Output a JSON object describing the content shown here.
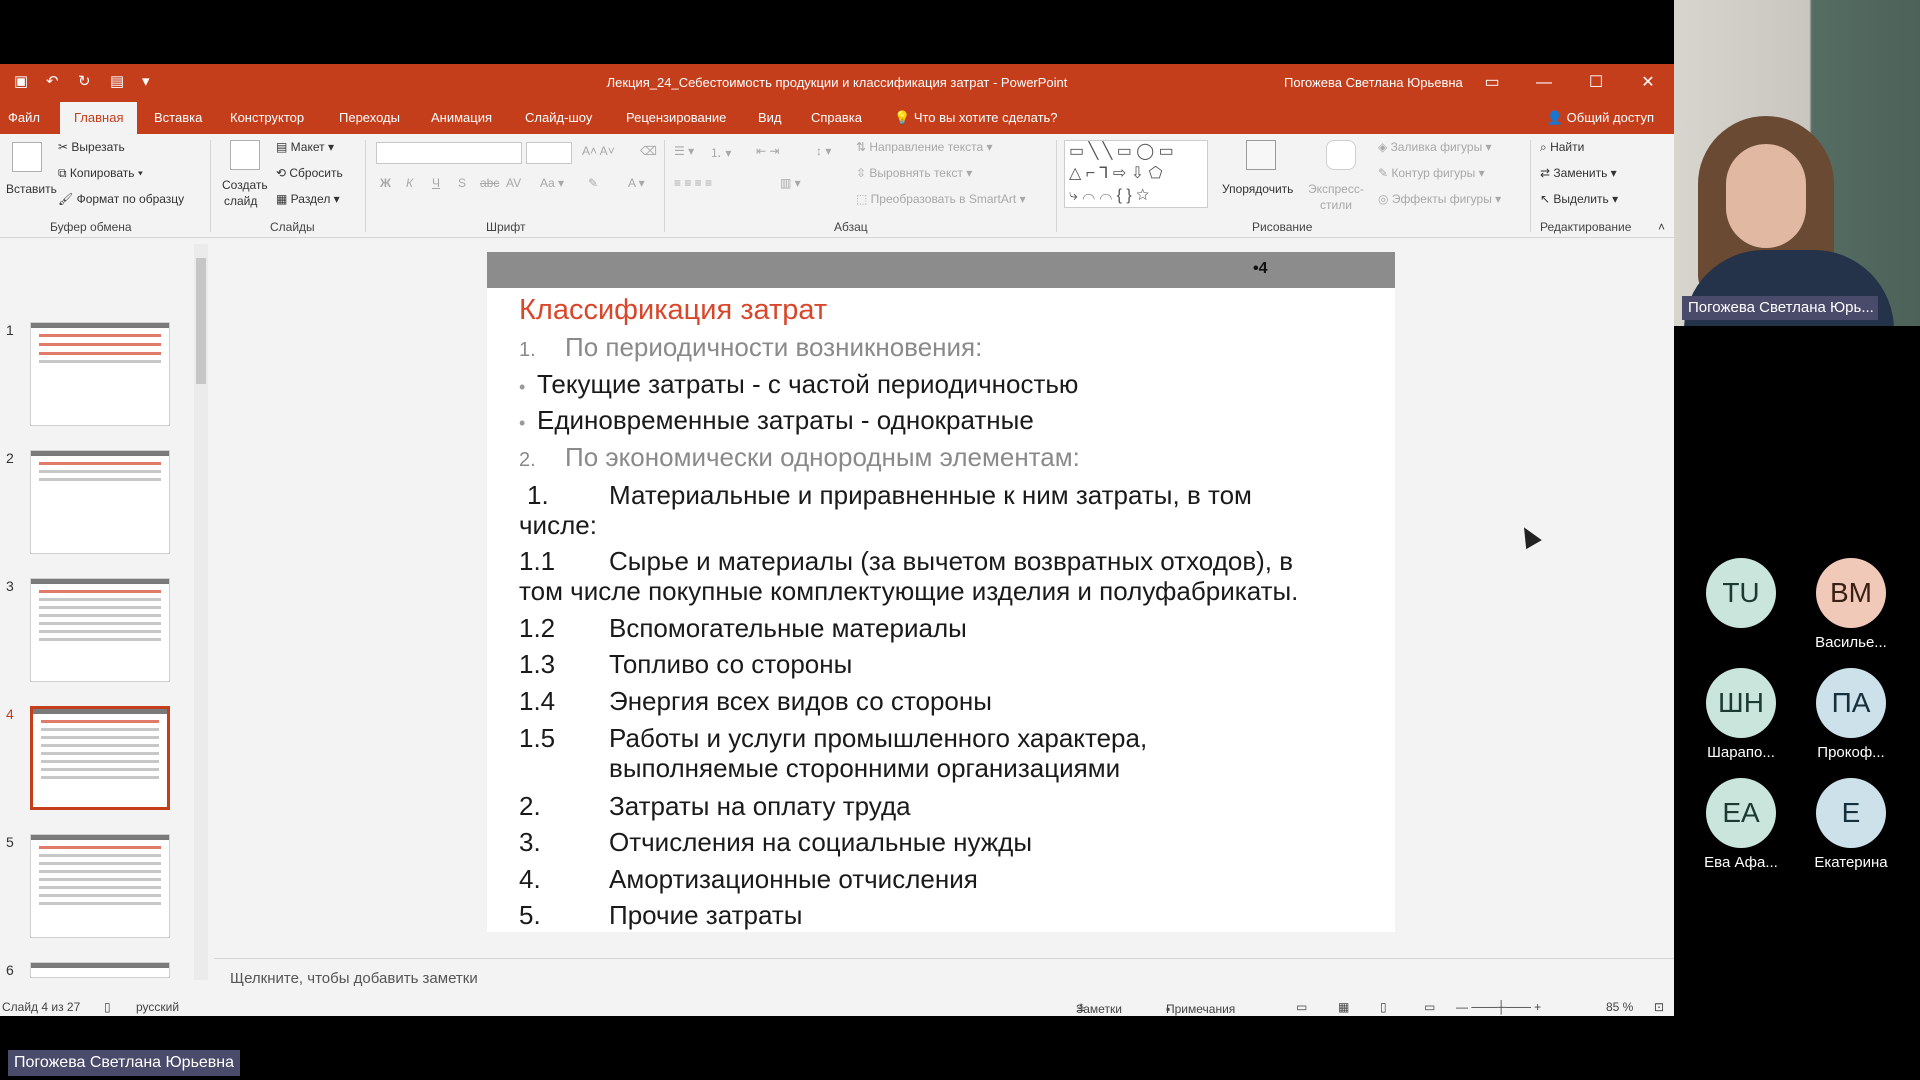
{
  "titlebar": {
    "document_title": "Лекция_24_Себестоимость продукции и классификация затрат  -  PowerPoint",
    "user": "Погожева Светлана Юрьевна"
  },
  "tabs": [
    "Файл",
    "Главная",
    "Вставка",
    "Конструктор",
    "Переходы",
    "Анимация",
    "Слайд-шоу",
    "Рецензирование",
    "Вид",
    "Справка",
    "Что вы хотите сделать?"
  ],
  "share_label": "Общий доступ",
  "ribbon": {
    "clipboard": {
      "paste": "Вставить",
      "cut": "Вырезать",
      "copy": "Копировать",
      "format_painter": "Формат по образцу",
      "label": "Буфер обмена"
    },
    "slides": {
      "new_slide_1": "Создать",
      "new_slide_2": "слайд",
      "layout": "Макет",
      "reset": "Сбросить",
      "section": "Раздел",
      "label": "Слайды"
    },
    "font": {
      "label": "Шрифт"
    },
    "paragraph": {
      "text_direction": "Направление текста",
      "align_text": "Выровнять текст",
      "smartart": "Преобразовать в SmartArt",
      "label": "Абзац"
    },
    "drawing": {
      "arrange": "Упорядочить",
      "quick_styles_1": "Экспресс-",
      "quick_styles_2": "стили",
      "fill": "Заливка фигуры",
      "outline": "Контур фигуры",
      "effects": "Эффекты фигуры",
      "label": "Рисование"
    },
    "editing": {
      "find": "Найти",
      "replace": "Заменить",
      "select": "Выделить",
      "label": "Редактирование"
    }
  },
  "thumbnails": [
    "1",
    "2",
    "3",
    "4",
    "5",
    "6"
  ],
  "slide": {
    "number": "•4",
    "title": "Классификация затрат",
    "s1_num": "1.",
    "s1_text": "По периодичности возникновения:",
    "b1": "Текущие затраты - с частой периодичностью",
    "b2": "Единовременные затраты - однократные",
    "s2_num": "2.",
    "s2_text": "По экономически однородным элементам:",
    "i1_num": "1.",
    "i1_text_a": "Материальные и приравненные к ним затраты, в том",
    "i1_text_b": "числе:",
    "i11_num": "1.1",
    "i11_text_a": "Сырье и материалы (за вычетом возвратных отходов), в",
    "i11_text_b": "том числе покупные комплектующие изделия и полуфабрикаты.",
    "i12_num": "1.2",
    "i12_text": "Вспомогательные материалы",
    "i13_num": "1.3",
    "i13_text": "Топливо со стороны",
    "i14_num": "1.4",
    "i14_text": "Энергия всех видов со стороны",
    "i15_num": "1.5",
    "i15_text_a": "Работы и услуги промышленного характера,",
    "i15_text_b": "выполняемые сторонними организациями",
    "i2_num": "2.",
    "i2_text": "Затраты на оплату труда",
    "i3_num": "3.",
    "i3_text": "Отчисления на социальные нужды",
    "i4_num": "4.",
    "i4_text": "Амортизационные отчисления",
    "i5_num": "5.",
    "i5_text": "Прочие затраты"
  },
  "notes_placeholder": "Щелкните, чтобы добавить заметки",
  "status": {
    "slide_of": "Слайд 4 из 27",
    "language": "русский",
    "notes": "Заметки",
    "comments": "Примечания",
    "zoom": "85 %"
  },
  "video": {
    "name": "Погожева Светлана Юрь..."
  },
  "participants": [
    {
      "initials": "TU",
      "name": ""
    },
    {
      "initials": "BM",
      "name": "Васильe..."
    },
    {
      "initials": "ШН",
      "name": "Шарапо..."
    },
    {
      "initials": "ПА",
      "name": "Прокоф..."
    },
    {
      "initials": "EA",
      "name": "Ева Афа..."
    },
    {
      "initials": "E",
      "name": "Екатерина"
    }
  ],
  "active_speaker": "Погожева Светлана Юрьевна"
}
